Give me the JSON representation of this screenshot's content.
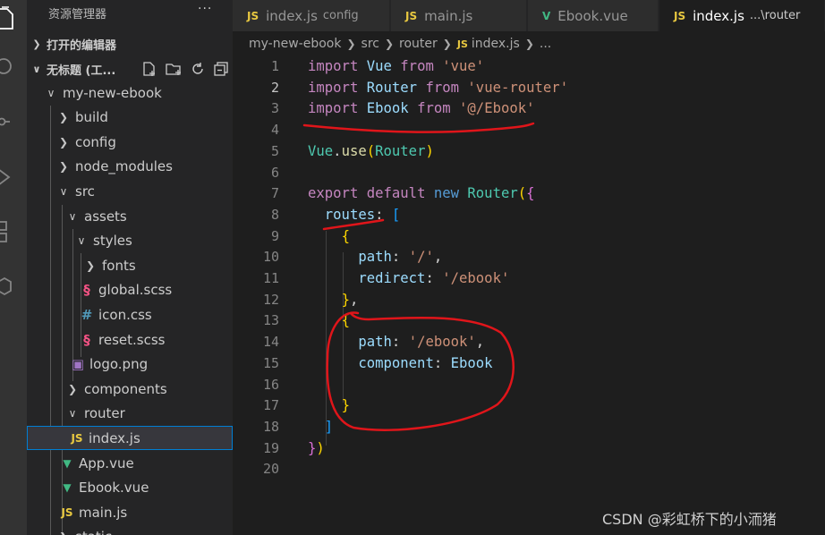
{
  "sidebar": {
    "title": "资源管理器",
    "more": "···",
    "open_editors": "打开的编辑器",
    "workspace": "无标题 (工...",
    "tree": [
      {
        "label": "my-new-ebook",
        "type": "folder-open"
      },
      {
        "label": "build",
        "type": "folder"
      },
      {
        "label": "config",
        "type": "folder"
      },
      {
        "label": "node_modules",
        "type": "folder"
      },
      {
        "label": "src",
        "type": "folder-open"
      },
      {
        "label": "assets",
        "type": "folder-open"
      },
      {
        "label": "styles",
        "type": "folder-open"
      },
      {
        "label": "fonts",
        "type": "folder"
      },
      {
        "label": "global.scss",
        "type": "scss"
      },
      {
        "label": "icon.css",
        "type": "css"
      },
      {
        "label": "reset.scss",
        "type": "scss"
      },
      {
        "label": "logo.png",
        "type": "image"
      },
      {
        "label": "components",
        "type": "folder"
      },
      {
        "label": "router",
        "type": "folder-open"
      },
      {
        "label": "index.js",
        "type": "js",
        "selected": true
      },
      {
        "label": "App.vue",
        "type": "vue"
      },
      {
        "label": "Ebook.vue",
        "type": "vue"
      },
      {
        "label": "main.js",
        "type": "js"
      },
      {
        "label": "static",
        "type": "folder"
      }
    ]
  },
  "tabs": [
    {
      "icon": "JS",
      "label": "index.js",
      "desc": "config",
      "active": false
    },
    {
      "icon": "JS",
      "label": "main.js",
      "desc": "",
      "active": false
    },
    {
      "icon": "V",
      "label": "Ebook.vue",
      "desc": "",
      "active": false
    },
    {
      "icon": "JS",
      "label": "index.js",
      "desc": "...\\router",
      "active": true
    }
  ],
  "breadcrumb": [
    "my-new-ebook",
    "src",
    "router",
    "index.js",
    "..."
  ],
  "editor": {
    "current_line": 2,
    "lines": [
      [
        [
          "kw",
          "import"
        ],
        [
          "pun",
          " "
        ],
        [
          "id",
          "Vue"
        ],
        [
          "pun",
          " "
        ],
        [
          "kw",
          "from"
        ],
        [
          "pun",
          " "
        ],
        [
          "str",
          "'vue'"
        ]
      ],
      [
        [
          "kw",
          "import"
        ],
        [
          "pun",
          " "
        ],
        [
          "id",
          "Router"
        ],
        [
          "pun",
          " "
        ],
        [
          "kw",
          "from"
        ],
        [
          "pun",
          " "
        ],
        [
          "str",
          "'vue-router'"
        ]
      ],
      [
        [
          "kw",
          "import"
        ],
        [
          "pun",
          " "
        ],
        [
          "id",
          "Ebook"
        ],
        [
          "pun",
          " "
        ],
        [
          "kw",
          "from"
        ],
        [
          "pun",
          " "
        ],
        [
          "str",
          "'@/Ebook'"
        ]
      ],
      [],
      [
        [
          "cls",
          "Vue"
        ],
        [
          "pun",
          "."
        ],
        [
          "fn",
          "use"
        ],
        [
          "b1",
          "("
        ],
        [
          "cls",
          "Router"
        ],
        [
          "b1",
          ")"
        ]
      ],
      [],
      [
        [
          "kw",
          "export"
        ],
        [
          "pun",
          " "
        ],
        [
          "kw",
          "default"
        ],
        [
          "pun",
          " "
        ],
        [
          "kwb",
          "new"
        ],
        [
          "pun",
          " "
        ],
        [
          "cls",
          "Router"
        ],
        [
          "b1",
          "("
        ],
        [
          "b2",
          "{"
        ]
      ],
      [
        [
          "pun",
          "  "
        ],
        [
          "id",
          "routes"
        ],
        [
          "pun",
          ": "
        ],
        [
          "b3",
          "["
        ]
      ],
      [
        [
          "pun",
          "    "
        ],
        [
          "b1",
          "{"
        ]
      ],
      [
        [
          "pun",
          "      "
        ],
        [
          "id",
          "path"
        ],
        [
          "pun",
          ": "
        ],
        [
          "str",
          "'/'"
        ],
        [
          "pun",
          ","
        ]
      ],
      [
        [
          "pun",
          "      "
        ],
        [
          "id",
          "redirect"
        ],
        [
          "pun",
          ": "
        ],
        [
          "str",
          "'/ebook'"
        ]
      ],
      [
        [
          "pun",
          "    "
        ],
        [
          "b1",
          "}"
        ],
        [
          "pun",
          ","
        ]
      ],
      [
        [
          "pun",
          "    "
        ],
        [
          "b1",
          "{"
        ]
      ],
      [
        [
          "pun",
          "      "
        ],
        [
          "id",
          "path"
        ],
        [
          "pun",
          ": "
        ],
        [
          "str",
          "'/ebook'"
        ],
        [
          "pun",
          ","
        ]
      ],
      [
        [
          "pun",
          "      "
        ],
        [
          "id",
          "component"
        ],
        [
          "pun",
          ": "
        ],
        [
          "id",
          "Ebook"
        ]
      ],
      [],
      [
        [
          "pun",
          "    "
        ],
        [
          "b1",
          "}"
        ]
      ],
      [
        [
          "pun",
          "  "
        ],
        [
          "b3",
          "]"
        ]
      ],
      [
        [
          "b2",
          "}"
        ],
        [
          "b1",
          ")"
        ]
      ],
      []
    ]
  },
  "watermark": "CSDN @彩虹桥下的小洏猪",
  "colors": {
    "js": "#e8c840",
    "vue": "#41b883",
    "scss": "#f55385",
    "css": "#519aba",
    "image": "#a074c4",
    "annotation": "#e0151a"
  }
}
